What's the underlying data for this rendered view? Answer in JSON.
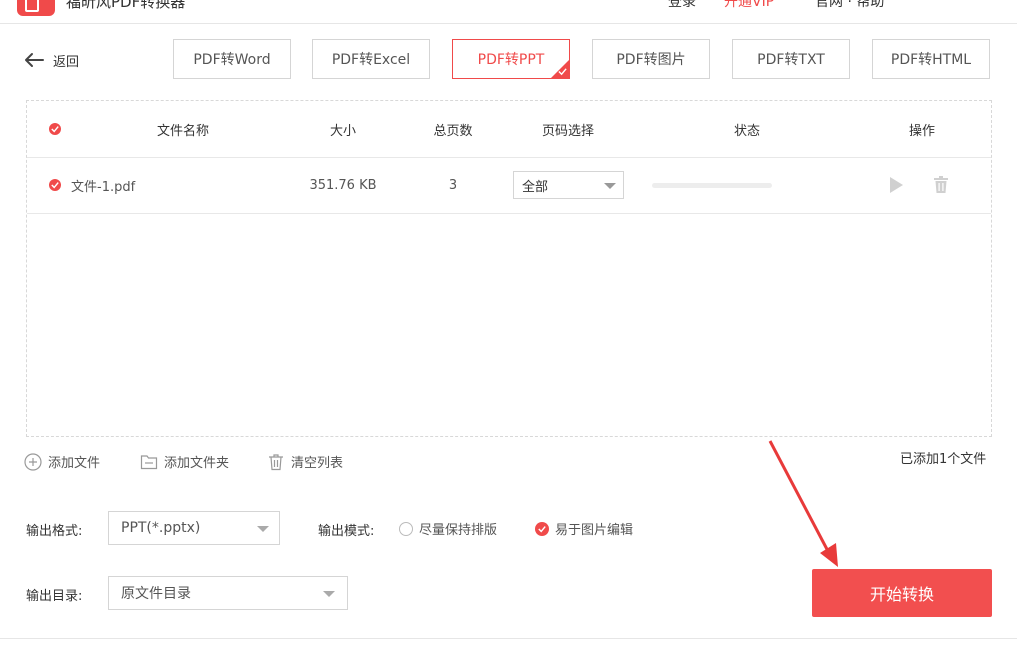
{
  "header": {
    "app_title": "福昕风PDF转换器",
    "user_label": "登录",
    "vip_label": "开通VIP",
    "version_label": "官网 · 帮助"
  },
  "nav": {
    "back_label": "返回"
  },
  "tabs": [
    {
      "label": "PDF转Word",
      "active": false
    },
    {
      "label": "PDF转Excel",
      "active": false
    },
    {
      "label": "PDF转PPT",
      "active": true
    },
    {
      "label": "PDF转图片",
      "active": false
    },
    {
      "label": "PDF转TXT",
      "active": false
    },
    {
      "label": "PDF转HTML",
      "active": false
    }
  ],
  "table": {
    "headers": {
      "file_name": "文件名称",
      "size": "大小",
      "pages": "总页数",
      "page_select": "页码选择",
      "status": "状态",
      "actions": "操作"
    },
    "rows": [
      {
        "file_name": "文件-1.pdf",
        "size": "351.76 KB",
        "pages": "3",
        "page_select": "全部",
        "progress": 0
      }
    ]
  },
  "file_actions": {
    "add_file": "添加文件",
    "add_folder": "添加文件夹",
    "clear_list": "清空列表",
    "added_count": "已添加1个文件"
  },
  "output": {
    "format_label": "输出格式:",
    "format_value": "PPT(*.pptx)",
    "mode_label": "输出模式:",
    "mode_options": [
      {
        "label": "尽量保持排版",
        "selected": false
      },
      {
        "label": "易于图片编辑",
        "selected": true
      }
    ],
    "dir_label": "输出目录:",
    "dir_value": "原文件目录"
  },
  "start_button": "开始转换",
  "colors": {
    "accent": "#f04a4a",
    "border": "#d5d5d5"
  }
}
